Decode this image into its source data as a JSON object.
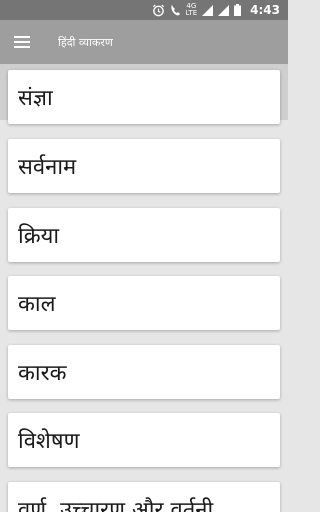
{
  "status_bar": {
    "time": "4:43",
    "icons": [
      "alarm-icon",
      "wifi-calling-icon",
      "4g-lte-icon",
      "signal-icon",
      "signal-icon",
      "battery-icon"
    ],
    "network_label": "4G",
    "lte_label": "LTE"
  },
  "app_bar": {
    "menu_icon": "hamburger-menu-icon",
    "title": "हिंदी व्याकरण"
  },
  "list": {
    "items": [
      {
        "label": "संज्ञा"
      },
      {
        "label": "सर्वनाम"
      },
      {
        "label": "क्रिया"
      },
      {
        "label": "काल"
      },
      {
        "label": "कारक"
      },
      {
        "label": "विशेषण"
      },
      {
        "label": "वर्ण, उच्चारण और वर्तनी"
      }
    ]
  },
  "colors": {
    "status_bar": "#757575",
    "app_bar": "#9e9e9e",
    "background": "#e6e6e6",
    "card": "#ffffff"
  }
}
